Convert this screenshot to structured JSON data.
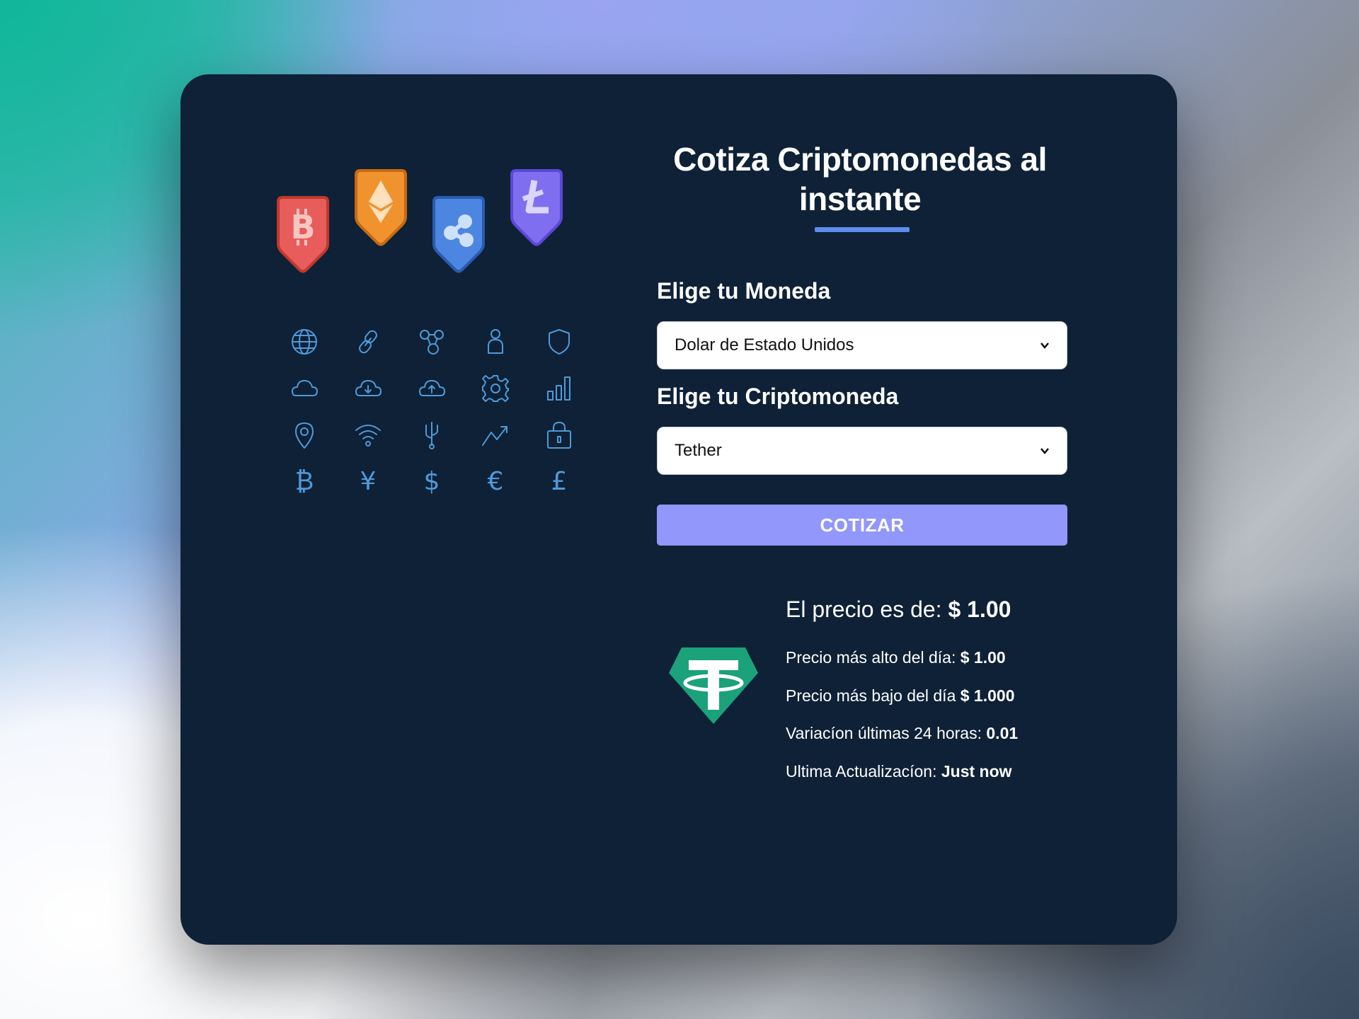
{
  "heading": "Cotiza Criptomonedas al instante",
  "currency": {
    "label": "Elige tu Moneda",
    "selected": "Dolar de Estado Unidos"
  },
  "crypto": {
    "label": "Elige tu Criptomoneda",
    "selected": "Tether"
  },
  "button_label": "COTIZAR",
  "result": {
    "price_label": "El precio es de:",
    "price_value": "$ 1.00",
    "high_label": "Precio más alto del día:",
    "high_value": "$ 1.00",
    "low_label": "Precio más bajo del día",
    "low_value": "$ 1.000",
    "change_label": "Variacíon últimas 24 horas:",
    "change_value": "0.01",
    "updated_label": "Ultima Actualizacíon:",
    "updated_value": "Just now"
  },
  "colors": {
    "card": "#0e2137",
    "accent": "#5c8ef0",
    "button": "#9197fb",
    "icon_stroke": "#4f9ad8",
    "bitcoin_badge": "#e85c5c",
    "ethereum_badge": "#f0922e",
    "ripple_badge": "#4c86e0",
    "litecoin_badge": "#7f6ff0",
    "tether_logo": "#1ba27a"
  },
  "icons": [
    "globe-icon",
    "link-icon",
    "network-icon",
    "user-icon",
    "shield-icon",
    "cloud-icon",
    "cloud-download-icon",
    "cloud-upload-icon",
    "gear-icon",
    "bar-chart-icon",
    "location-pin-icon",
    "wifi-icon",
    "usb-icon",
    "trend-up-icon",
    "lock-icon",
    "bitcoin-icon",
    "yen-icon",
    "dollar-icon",
    "euro-icon",
    "pound-icon"
  ]
}
